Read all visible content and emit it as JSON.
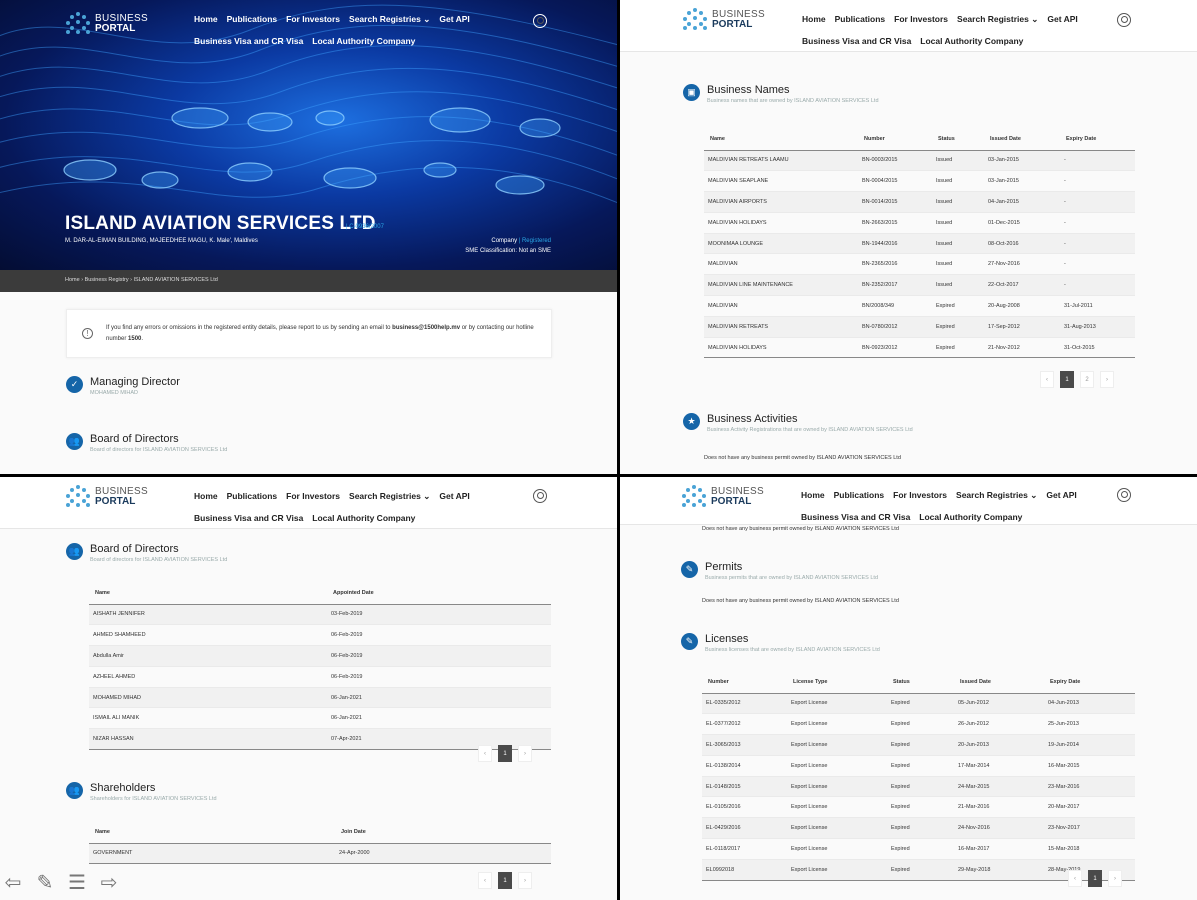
{
  "nav": {
    "logo_line1": "BUSINESS",
    "logo_line2": "PORTAL",
    "links_row1": [
      "Home",
      "Publications",
      "For Investors",
      "Search Registries",
      "Get API"
    ],
    "links_row2": [
      "Business Visa and CR Visa",
      "Local Authority Company"
    ],
    "dropdown_caret": "⌄"
  },
  "hero": {
    "title": "ISLAND AVIATION SERVICES LTD",
    "reg_no": "| C-0936/2007",
    "address": "M. DAR-AL-EIMAN BUILDING, MAJEEDHEE MAGU, K. Male', Maldives",
    "type_label": "Company",
    "status_label": "| Registered",
    "sme": "SME Classification: Not an SME"
  },
  "breadcrumb": [
    "Home",
    "Business Registry",
    "ISLAND AVIATION SERVICES Ltd"
  ],
  "notice": {
    "text_before": "If you find any errors or omissions in the registered entity details, please report to us by sending an email to ",
    "email": "business@1500help.mv",
    "text_middle": " or by contacting our hotline number ",
    "hotline": "1500",
    "text_after": "."
  },
  "managing_director": {
    "title": "Managing Director",
    "sub": "MOHAMED MIHAD"
  },
  "board": {
    "title": "Board of Directors",
    "sub": "Board of directors for ISLAND AVIATION SERVICES Ltd",
    "columns": [
      "Name",
      "Appointed Date"
    ],
    "rows": [
      [
        "AISHATH JENNIFER",
        "03-Feb-2019"
      ],
      [
        "AHMED SHAMHEED",
        "06-Feb-2019"
      ],
      [
        "Abdulla Amir",
        "06-Feb-2019"
      ],
      [
        "AZHEEL AHMED",
        "06-Feb-2019"
      ],
      [
        "MOHAMED MIHAD",
        "06-Jan-2021"
      ],
      [
        "ISMAIL ALI MANIK",
        "06-Jan-2021"
      ],
      [
        "NIZAR HASSAN",
        "07-Apr-2021"
      ]
    ],
    "pager": [
      "‹",
      "1",
      "›"
    ]
  },
  "shareholders": {
    "title": "Shareholders",
    "sub": "Shareholders for ISLAND AVIATION SERVICES Ltd",
    "columns": [
      "Name",
      "Join Date"
    ],
    "rows": [
      [
        "GOVERNMENT",
        "24-Apr-2000"
      ]
    ],
    "pager": [
      "‹",
      "1",
      "›"
    ]
  },
  "business_names": {
    "title": "Business Names",
    "sub": "Business names that are owned by ISLAND AVIATION SERVICES Ltd",
    "columns": [
      "Name",
      "Number",
      "Status",
      "Issued Date",
      "Expiry Date"
    ],
    "rows": [
      [
        "MALDIVIAN RETREATS LAAMU",
        "BN-0003/2015",
        "Issued",
        "03-Jan-2015",
        "-"
      ],
      [
        "MALDIVIAN SEAPLANE",
        "BN-0004/2015",
        "Issued",
        "03-Jan-2015",
        "-"
      ],
      [
        "MALDIVIAN AIRPORTS",
        "BN-0014/2015",
        "Issued",
        "04-Jan-2015",
        "-"
      ],
      [
        "MALDIVIAN HOLIDAYS",
        "BN-2663/2015",
        "Issued",
        "01-Dec-2015",
        "-"
      ],
      [
        "MOONIMAA LOUNGE",
        "BN-1944/2016",
        "Issued",
        "08-Oct-2016",
        "-"
      ],
      [
        "MALDIVIAN",
        "BN-2365/2016",
        "Issued",
        "27-Nov-2016",
        "-"
      ],
      [
        "MALDIVIAN LINE MAINTENANCE",
        "BN-2352/2017",
        "Issued",
        "22-Oct-2017",
        "-"
      ],
      [
        "MALDIVIAN",
        "BN/2008/349",
        "Expired",
        "20-Aug-2008",
        "31-Jul-2011"
      ],
      [
        "MALDIVIAN RETREATS",
        "BN-0780/2012",
        "Expired",
        "17-Sep-2012",
        "31-Aug-2013"
      ],
      [
        "MALDIVIAN HOLIDAYS",
        "BN-0923/2012",
        "Expired",
        "21-Nov-2012",
        "31-Oct-2015"
      ]
    ],
    "pager": [
      "‹",
      "1",
      "2",
      "›"
    ]
  },
  "business_activities": {
    "title": "Business Activities",
    "sub": "Business Activity Registrations that are owned by ISLAND AVIATION SERVICES Ltd",
    "note": "Does not have any business permit owned by ISLAND AVIATION SERVICES Ltd"
  },
  "permits": {
    "title": "Permits",
    "sub": "Business permits that are owned by ISLAND AVIATION SERVICES Ltd",
    "note": "Does not have any business permit owned by ISLAND AVIATION SERVICES Ltd"
  },
  "licenses": {
    "title": "Licenses",
    "sub": "Business licenses that are owned by ISLAND AVIATION SERVICES Ltd",
    "columns": [
      "Number",
      "License Type",
      "Status",
      "Issued Date",
      "Expiry Date"
    ],
    "rows": [
      [
        "EL-0335/2012",
        "Export License",
        "Expired",
        "05-Jun-2012",
        "04-Jun-2013"
      ],
      [
        "EL-0377/2012",
        "Export License",
        "Expired",
        "26-Jun-2012",
        "25-Jun-2013"
      ],
      [
        "EL-3065/2013",
        "Export License",
        "Expired",
        "20-Jun-2013",
        "19-Jun-2014"
      ],
      [
        "EL-0138/2014",
        "Export License",
        "Expired",
        "17-Mar-2014",
        "16-Mar-2015"
      ],
      [
        "EL-0148/2015",
        "Export License",
        "Expired",
        "24-Mar-2015",
        "23-Mar-2016"
      ],
      [
        "EL-0105/2016",
        "Export License",
        "Expired",
        "21-Mar-2016",
        "20-Mar-2017"
      ],
      [
        "EL-0429/2016",
        "Export License",
        "Expired",
        "24-Nov-2016",
        "23-Nov-2017"
      ],
      [
        "EL-0118/2017",
        "Export License",
        "Expired",
        "16-Mar-2017",
        "15-Mar-2018"
      ],
      [
        "EL0992018",
        "Export License",
        "Expired",
        "29-May-2018",
        "28-May-2019"
      ]
    ],
    "pager": [
      "‹",
      "1",
      "›"
    ]
  },
  "icons": {
    "accent": "#1565a8",
    "section_icons": [
      "check-icon",
      "people-icon",
      "building-icon",
      "star-icon",
      "tag-icon"
    ]
  },
  "toolbar": [
    "⇦",
    "✎",
    "☰",
    "⇨"
  ]
}
